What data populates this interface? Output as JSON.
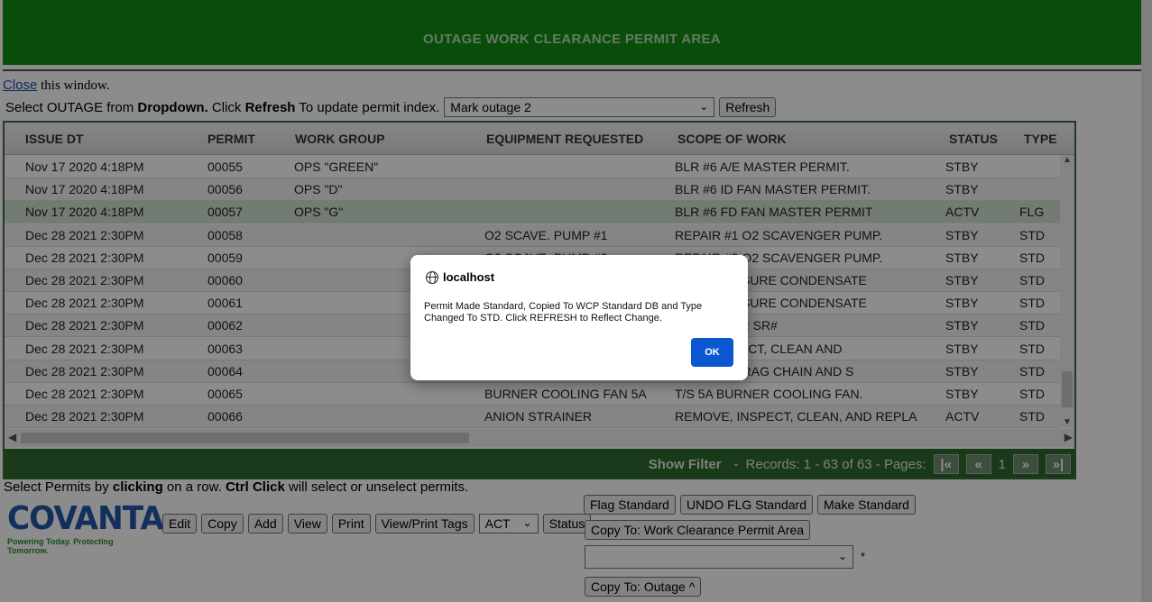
{
  "header": {
    "title": "OUTAGE WORK CLEARANCE PERMIT AREA"
  },
  "close_line": {
    "link": "Close",
    "rest": " this window."
  },
  "select_line": {
    "prefix": "Select OUTAGE from ",
    "bold1": "Dropdown.",
    "mid": " Click ",
    "bold2": "Refresh",
    "suffix": " To update permit index.",
    "outage_selected": "Mark outage 2",
    "refresh_button": "Refresh"
  },
  "grid": {
    "columns": [
      "ISSUE DT",
      "PERMIT",
      "WORK GROUP",
      "EQUIPMENT REQUESTED",
      "SCOPE OF WORK",
      "STATUS",
      "TYPE"
    ],
    "rows": [
      [
        "Nov 17 2020 4:18PM",
        "00055",
        "OPS \"GREEN\"",
        "",
        "BLR #6 A/E MASTER PERMIT.",
        "STBY",
        ""
      ],
      [
        "Nov 17 2020 4:18PM",
        "00056",
        "OPS \"D\"",
        "",
        "BLR #6 ID FAN MASTER PERMIT.",
        "STBY",
        ""
      ],
      [
        "Nov 17 2020 4:18PM",
        "00057",
        "OPS \"G\"",
        "",
        "BLR #6 FD FAN MASTER PERMIT",
        "ACTV",
        "FLG"
      ],
      [
        "Dec 28 2021 2:30PM",
        "00058",
        "",
        "O2 SCAVE. PUMP #1",
        "REPAIR #1 O2 SCAVENGER PUMP.",
        "STBY",
        "STD"
      ],
      [
        "Dec 28 2021 2:30PM",
        "00059",
        "",
        "O2 SCAVE. PUMP #2",
        "REPAIR #2 O2 SCAVENGER PUMP.",
        "STBY",
        "STD"
      ],
      [
        "Dec 28 2021 2:30PM",
        "00060",
        "",
        "",
        "LOW PRESSURE CONDENSATE",
        "STBY",
        "STD"
      ],
      [
        "Dec 28 2021 2:30PM",
        "00061",
        "",
        "",
        "LOW PRESSURE CONDENSATE",
        "STBY",
        "STD"
      ],
      [
        "Dec 28 2021 2:30PM",
        "00062",
        "",
        "",
        "A ATOMIZER SR#",
        "STBY",
        "STD"
      ],
      [
        "Dec 28 2021 2:30PM",
        "00063",
        "",
        "",
        "LL #5-INSPECT, CLEAN AND",
        "STBY",
        "STD"
      ],
      [
        "Dec 28 2021 2:30PM",
        "00064",
        "",
        "",
        "GHOUSE DRAG CHAIN AND S",
        "STBY",
        "STD"
      ],
      [
        "Dec 28 2021 2:30PM",
        "00065",
        "",
        "BURNER COOLING FAN 5A",
        "T/S 5A BURNER COOLING FAN.",
        "STBY",
        "STD"
      ],
      [
        "Dec 28 2021 2:30PM",
        "00066",
        "",
        "ANION STRAINER",
        "REMOVE, INSPECT, CLEAN, AND REPLA",
        "ACTV",
        "STD"
      ]
    ],
    "selected_row_index": 2
  },
  "pager": {
    "show_filter": "Show Filter",
    "dash": "-",
    "records": "Records: 1 - 63 of 63 - Pages:",
    "page": "1",
    "first": "|<<",
    "prev": "<<",
    "next": ">>",
    "last": ">>|"
  },
  "bottom": {
    "t1": "Select Permits by ",
    "b1": "clicking",
    "t2": " on a row. ",
    "b2": "Ctrl Click",
    "t3": " will select or unselect permits.",
    "logo_word": "COVANTA",
    "logo_tag": "Powering Today. Protecting Tomorrow.",
    "buttons": [
      "Edit",
      "Copy",
      "Add",
      "View",
      "Print",
      "View/Print Tags"
    ],
    "status_select": "ACT",
    "status_button": "Status",
    "flag_standard": "Flag Standard",
    "undo_flg": "UNDO FLG Standard",
    "make_standard": "Make Standard",
    "copy_to_wcp": "Copy To: Work Clearance Permit Area",
    "required_mark": "*",
    "copy_to_outage": "Copy To: Outage ^"
  },
  "dialog": {
    "origin": "localhost",
    "message": "Permit Made Standard, Copied To WCP Standard DB and Type Changed To STD. Click REFRESH to Reflect Change.",
    "ok": "OK"
  },
  "colors": {
    "header_bg": "#138a13",
    "pager_bg": "#2e6b2e",
    "ok_button": "#0b57d0"
  }
}
